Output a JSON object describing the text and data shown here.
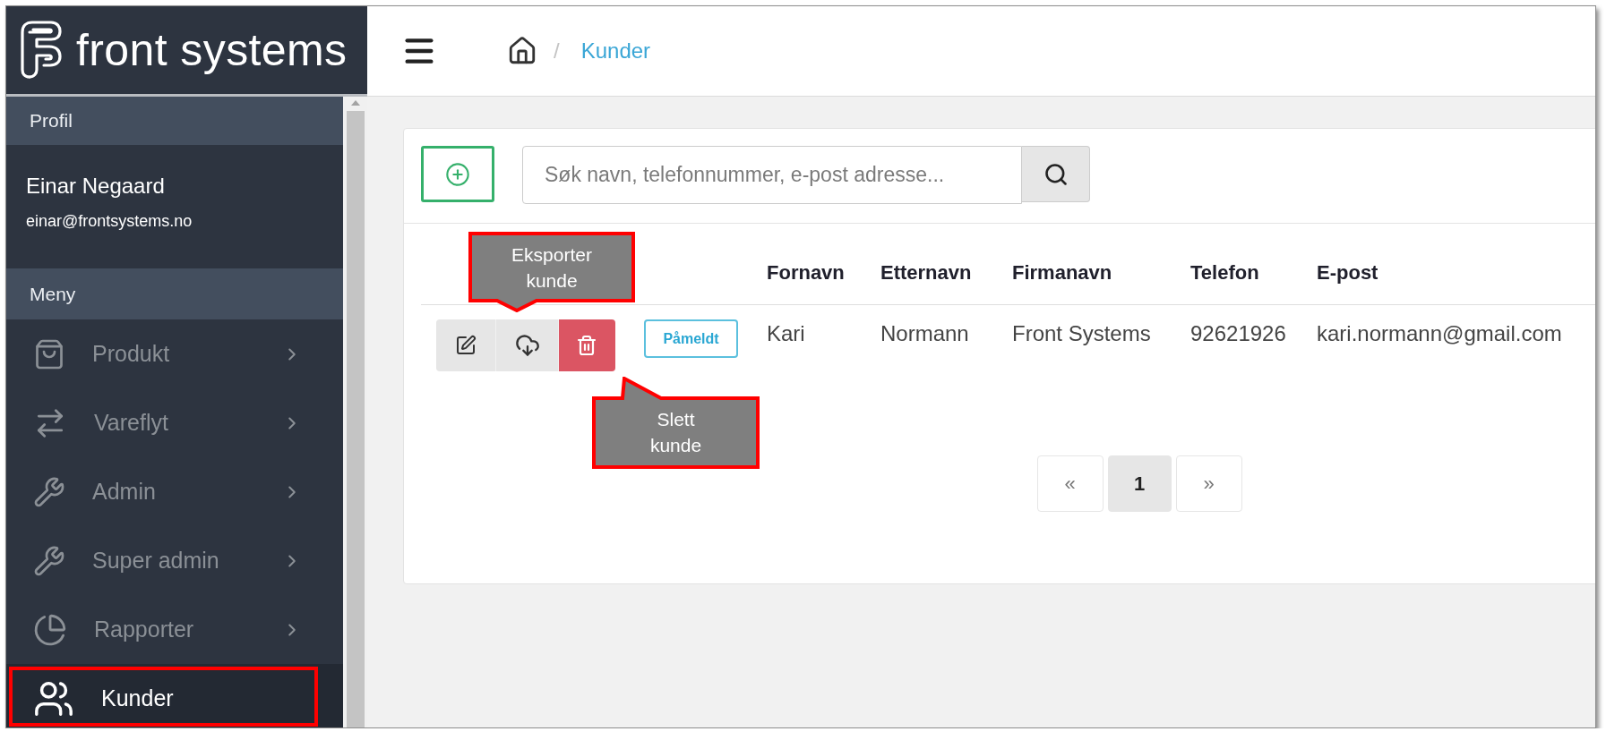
{
  "logo": {
    "text": "front systems"
  },
  "header": {
    "breadcrumb": {
      "separator": "/",
      "current": "Kunder"
    }
  },
  "sidebar": {
    "profile_title": "Profil",
    "user": {
      "name": "Einar Negaard",
      "email": "einar@frontsystems.no"
    },
    "menu_title": "Meny",
    "items": [
      {
        "label": "Produkt",
        "submenu": true,
        "selected": false,
        "annotated": false
      },
      {
        "label": "Vareflyt",
        "submenu": true,
        "selected": false,
        "annotated": false
      },
      {
        "label": "Admin",
        "submenu": true,
        "selected": false,
        "annotated": false
      },
      {
        "label": "Super admin",
        "submenu": true,
        "selected": false,
        "annotated": false
      },
      {
        "label": "Rapporter",
        "submenu": true,
        "selected": false,
        "annotated": false
      },
      {
        "label": "Kunder",
        "submenu": false,
        "selected": true,
        "annotated": true
      }
    ]
  },
  "toolbar": {
    "search": {
      "placeholder": "Søk navn, telefonnummer, e-post adresse..."
    }
  },
  "table": {
    "columns": [
      "Fornavn",
      "Etternavn",
      "Firmanavn",
      "Telefon",
      "E-post"
    ],
    "rows": [
      {
        "status": "Påmeldt",
        "cells": [
          "Kari",
          "Normann",
          "Front Systems",
          "92621926",
          "kari.normann@gmail.com"
        ]
      }
    ]
  },
  "pagination": {
    "previous": "«",
    "pages": [
      {
        "label": "1",
        "selected": true
      }
    ],
    "next": "»"
  },
  "callouts": [
    {
      "text": "Eksporter kunde",
      "kind": "above"
    },
    {
      "text": "Slett kunde",
      "kind": "below"
    }
  ]
}
